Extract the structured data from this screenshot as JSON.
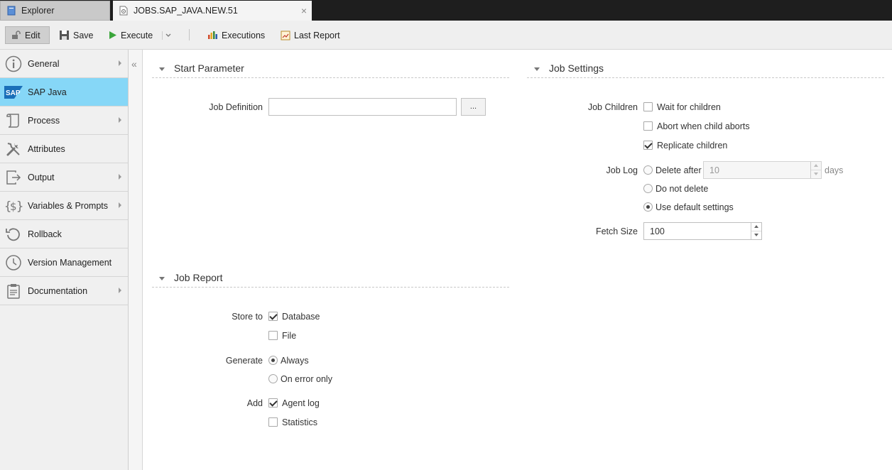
{
  "tabs": {
    "explorer_label": "Explorer",
    "job_label": "JOBS.SAP_JAVA.NEW.51",
    "close_glyph": "×"
  },
  "toolbar": {
    "edit_label": "Edit",
    "save_label": "Save",
    "execute_label": "Execute",
    "executions_label": "Executions",
    "last_report_label": "Last Report"
  },
  "sidebar": {
    "items": [
      {
        "label": "General",
        "icon": "info-icon",
        "has_arrow": true
      },
      {
        "label": "SAP Java",
        "icon": "sap-logo-icon",
        "has_arrow": false,
        "active": true
      },
      {
        "label": "Process",
        "icon": "scroll-icon",
        "has_arrow": true
      },
      {
        "label": "Attributes",
        "icon": "tools-icon",
        "has_arrow": false
      },
      {
        "label": "Output",
        "icon": "output-icon",
        "has_arrow": true
      },
      {
        "label": "Variables & Prompts",
        "icon": "variables-icon",
        "has_arrow": true
      },
      {
        "label": "Rollback",
        "icon": "rollback-icon",
        "has_arrow": false
      },
      {
        "label": "Version Management",
        "icon": "clock-icon",
        "has_arrow": false
      },
      {
        "label": "Documentation",
        "icon": "clipboard-icon",
        "has_arrow": true
      }
    ],
    "sap_logo_text": "SAP",
    "collapse_glyph": "«"
  },
  "start_parameter": {
    "title": "Start Parameter",
    "job_definition_label": "Job Definition",
    "job_definition_value": "",
    "browse_label": "..."
  },
  "job_settings": {
    "title": "Job Settings",
    "job_children_label": "Job Children",
    "wait_for_children": {
      "label": "Wait for children",
      "checked": false
    },
    "abort_when_child_aborts": {
      "label": "Abort when child aborts",
      "checked": false
    },
    "replicate_children": {
      "label": "Replicate children",
      "checked": true
    },
    "job_log_label": "Job Log",
    "delete_after": {
      "label": "Delete after",
      "checked": false,
      "value": "10",
      "unit": "days"
    },
    "do_not_delete": {
      "label": "Do not delete",
      "checked": false
    },
    "use_default_settings": {
      "label": "Use default settings",
      "checked": true
    },
    "fetch_size_label": "Fetch Size",
    "fetch_size_value": "100"
  },
  "job_report": {
    "title": "Job Report",
    "store_to_label": "Store to",
    "database": {
      "label": "Database",
      "checked": true
    },
    "file": {
      "label": "File",
      "checked": false
    },
    "generate_label": "Generate",
    "always": {
      "label": "Always",
      "checked": true
    },
    "on_error_only": {
      "label": "On error only",
      "checked": false
    },
    "add_label": "Add",
    "agent_log": {
      "label": "Agent log",
      "checked": true
    },
    "statistics": {
      "label": "Statistics",
      "checked": false
    }
  },
  "colors": {
    "active_sidebar": "#86d7f7",
    "tabbar_bg": "#1e1e1e",
    "execute_green": "#3aa53a",
    "sap_blue": "#1a6fb8"
  }
}
